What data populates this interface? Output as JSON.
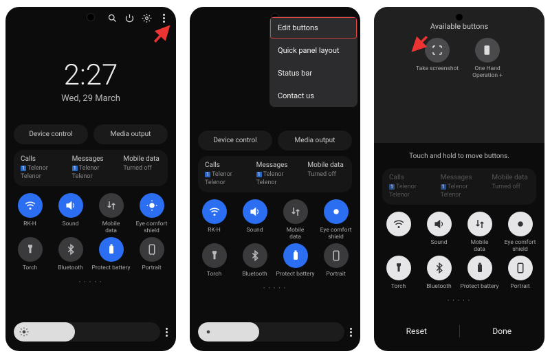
{
  "clock": {
    "time": "2:27",
    "date": "Wed, 29 March"
  },
  "pills": {
    "device": "Device control",
    "media": "Media output"
  },
  "sim": {
    "calls": {
      "title": "Calls",
      "l1": "Telenor",
      "l2": "Telenor"
    },
    "messages": {
      "title": "Messages",
      "l1": "Telenor",
      "l2": "Telenor"
    },
    "mobile": {
      "title": "Mobile data",
      "l1": "Turned off"
    },
    "tag": "1"
  },
  "toggles": {
    "wifi": "RK-H",
    "sound": "Sound",
    "mobiledata": "Mobile\ndata",
    "eye": "Eye comfort\nshield",
    "torch": "Torch",
    "bt": "Bluetooth",
    "battery": "Protect battery",
    "portrait": "Portrait"
  },
  "menu": {
    "edit": "Edit buttons",
    "layout": "Quick panel layout",
    "status": "Status bar",
    "contact": "Contact us"
  },
  "p3": {
    "title": "Available buttons",
    "screenshot": "Take screenshot",
    "onehand": "One Hand\nOperation +",
    "hint": "Touch and hold to move buttons.",
    "reset": "Reset",
    "done": "Done"
  }
}
